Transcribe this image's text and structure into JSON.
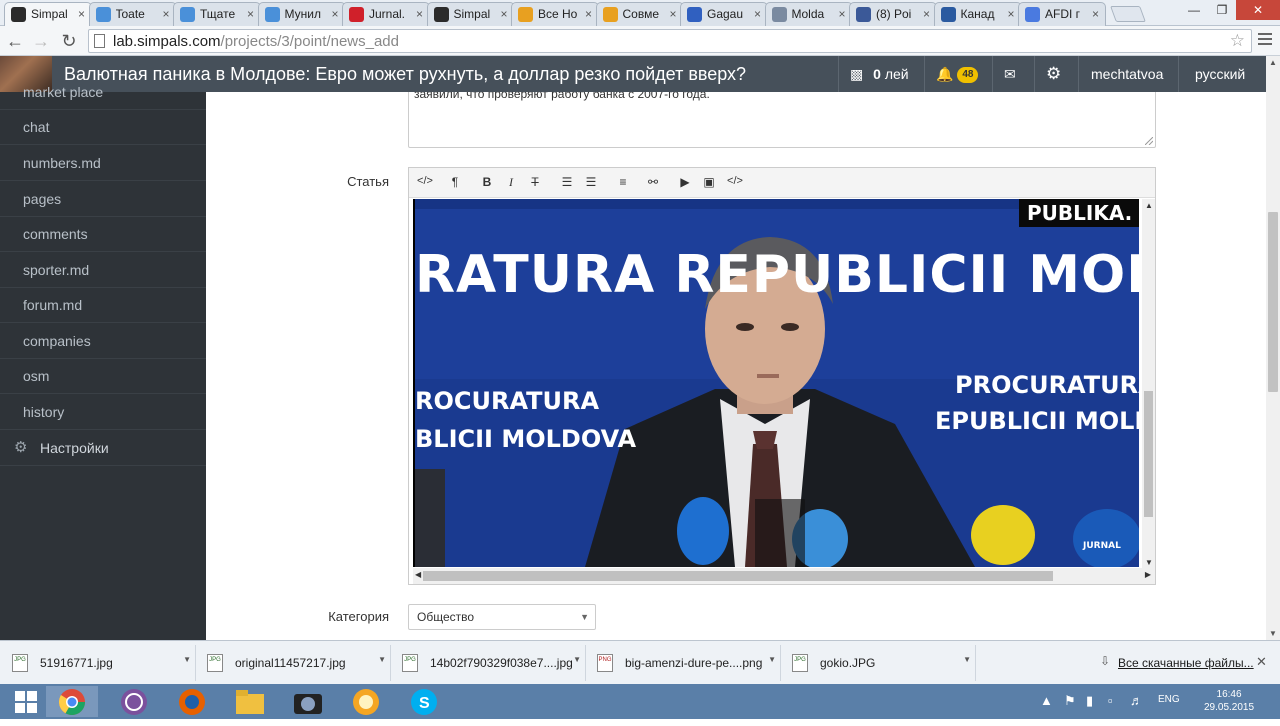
{
  "browser": {
    "tabs": [
      {
        "label": "Simpal",
        "icon": "simpals-icon",
        "color": "#2b2b2b",
        "active": true
      },
      {
        "label": "Toate",
        "icon": "doc-icon",
        "color": "#4a90d9"
      },
      {
        "label": "Тщате",
        "icon": "doc-icon",
        "color": "#4a90d9"
      },
      {
        "label": "Мунил",
        "icon": "doc-icon",
        "color": "#4a90d9"
      },
      {
        "label": "Jurnal.",
        "icon": "jurnal-icon",
        "color": "#d0202a"
      },
      {
        "label": "Simpal",
        "icon": "simpals-icon",
        "color": "#2b2b2b"
      },
      {
        "label": "Все Но",
        "icon": "pizza-icon",
        "color": "#e8a020"
      },
      {
        "label": "Совме",
        "icon": "pizza-icon",
        "color": "#e8a020"
      },
      {
        "label": "Gagau",
        "icon": "flag-icon",
        "color": "#3060c0"
      },
      {
        "label": "Molda",
        "icon": "m-icon",
        "color": "#7a8aa0"
      },
      {
        "label": "(8) Poi",
        "icon": "facebook-icon",
        "color": "#3b5998"
      },
      {
        "label": "Канад",
        "icon": "tv-icon",
        "color": "#2a5aa0"
      },
      {
        "label": "AFDI г",
        "icon": "g-icon",
        "color": "#4a7ae0"
      }
    ],
    "url_host": "lab.simpals.com",
    "url_path": "/projects/3/point/news_add"
  },
  "header": {
    "title": "Валютная паника в Молдове: Евро может рухнуть, а доллар резко пойдет вверх?",
    "balance_value": "0",
    "balance_unit": "лей",
    "notifications_count": "48",
    "username": "mechtatvoa",
    "language": "русский"
  },
  "sidebar": {
    "items": [
      {
        "label": "market place"
      },
      {
        "label": "chat"
      },
      {
        "label": "numbers.md"
      },
      {
        "label": "pages"
      },
      {
        "label": "comments"
      },
      {
        "label": "sporter.md"
      },
      {
        "label": "forum.md"
      },
      {
        "label": "companies"
      },
      {
        "label": "osm"
      },
      {
        "label": "history"
      }
    ],
    "settings_label": "Настройки"
  },
  "form": {
    "lead_text": "заявили, что проверяют работу банка с 2007-го года.",
    "article_label": "Статья",
    "category_label": "Категория",
    "category_value": "Общество",
    "toolbar": {
      "html": "</>",
      "paragraph": "¶",
      "bold": "B",
      "italic": "I",
      "strike": "T",
      "html2": "</>"
    },
    "image": {
      "watermark": "PUBLIKA.",
      "banner_top": "RATURA REPUBLICII MOLDOVA",
      "banner_left_1": "ROCURATURA",
      "banner_left_2": "BLICII MOLDOVA",
      "banner_right_1": "PROCURATURA",
      "banner_right_2": "EPUBLICII MOLDOV",
      "mic_label": "JURNAL"
    }
  },
  "downloads": {
    "items": [
      {
        "name": "51916771.jpg",
        "type": "JPG"
      },
      {
        "name": "original11457217.jpg",
        "type": "JPG"
      },
      {
        "name": "14b02f790329f038e7....jpg",
        "type": "JPG"
      },
      {
        "name": "big-amenzi-dure-pe....png",
        "type": "PNG"
      },
      {
        "name": "gokio.JPG",
        "type": "JPG"
      }
    ],
    "show_all": "Все скачанные файлы..."
  },
  "taskbar": {
    "lang": "ENG",
    "time": "16:46",
    "date": "29.05.2015"
  }
}
